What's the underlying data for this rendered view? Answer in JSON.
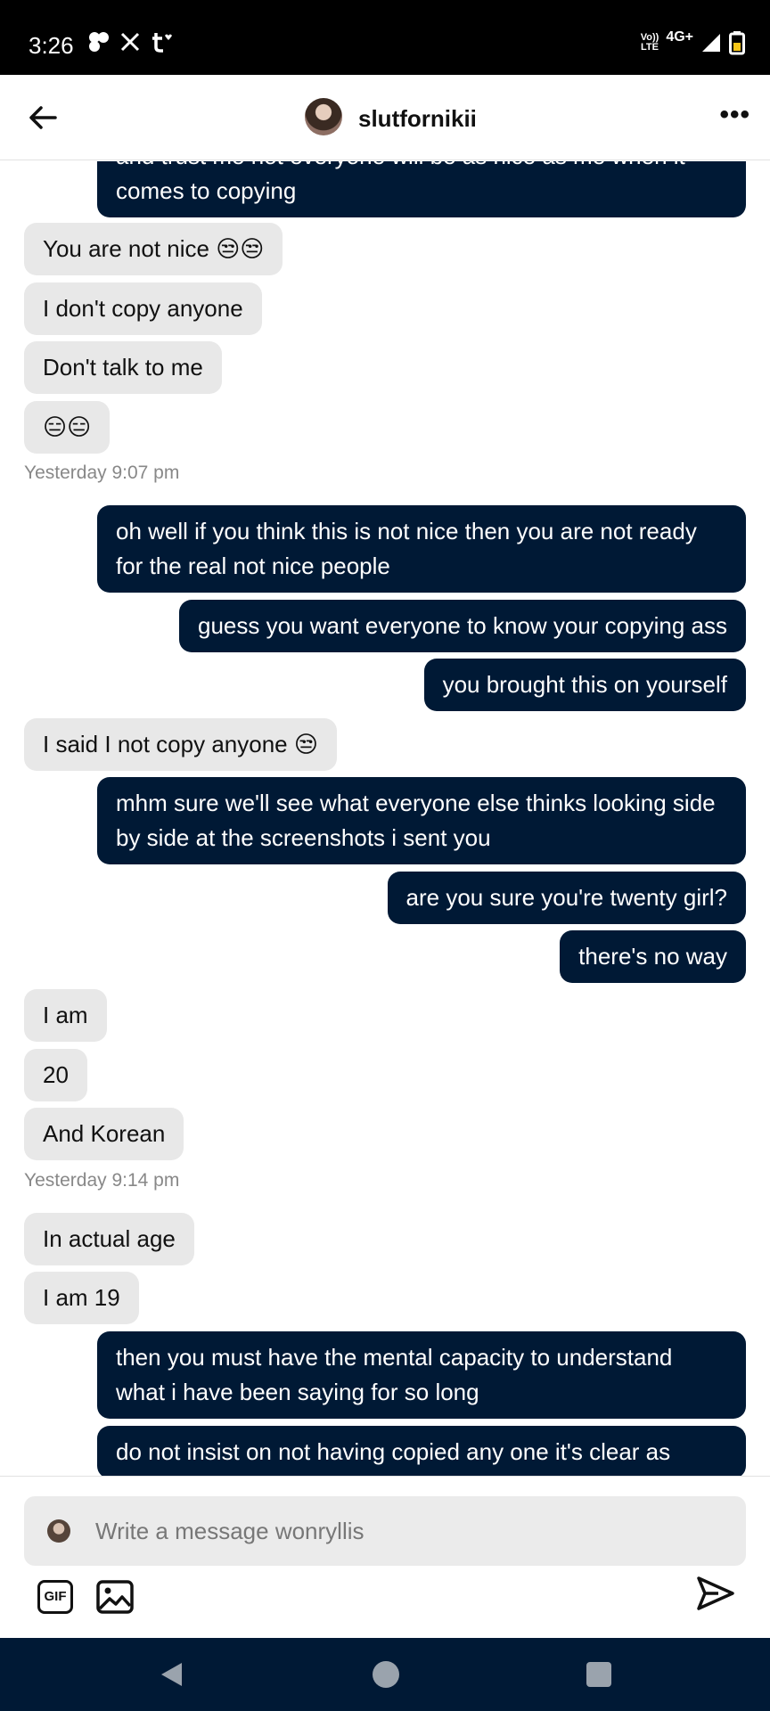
{
  "status": {
    "time": "3:26",
    "volte_line1": "Vo))",
    "volte_line2": "LTE",
    "network": "4G+"
  },
  "header": {
    "contact": "slutfornikii"
  },
  "messages": [
    {
      "dir": "out",
      "text": "and trust me not everyone will be as nice as me when it comes to copying"
    },
    {
      "dir": "in",
      "text": "You are not nice 😒😒"
    },
    {
      "dir": "in",
      "text": "I don't copy anyone"
    },
    {
      "dir": "in",
      "text": "Don't talk to me"
    },
    {
      "dir": "in",
      "text": "😑😑"
    },
    {
      "dir": "stamp",
      "text": "Yesterday 9:07 pm"
    },
    {
      "dir": "out",
      "text": "oh well if you think this is not nice then you are not ready for the real not nice people"
    },
    {
      "dir": "out",
      "text": "guess you want everyone to know your copying ass"
    },
    {
      "dir": "out",
      "text": "you brought this on yourself"
    },
    {
      "dir": "in",
      "text": "I said I not copy anyone 😒"
    },
    {
      "dir": "out",
      "text": "mhm sure we'll see what everyone else thinks looking side by side at the screenshots i sent you"
    },
    {
      "dir": "out",
      "text": "are you sure you're twenty girl?"
    },
    {
      "dir": "out",
      "text": "there's no way"
    },
    {
      "dir": "in",
      "text": "I am"
    },
    {
      "dir": "in",
      "text": "20"
    },
    {
      "dir": "in",
      "text": "And Korean"
    },
    {
      "dir": "stamp",
      "text": "Yesterday 9:14 pm"
    },
    {
      "dir": "in",
      "text": "In actual age"
    },
    {
      "dir": "in",
      "text": "I am 19"
    },
    {
      "dir": "out",
      "text": "then you must have the mental capacity to understand what i have been saying for so long"
    },
    {
      "dir": "out",
      "text": "do not insist on not having copied any one it's clear as"
    }
  ],
  "composer": {
    "placeholder": "Write a message wonryllis",
    "gif_label": "GIF"
  },
  "icons": {
    "back": "back-arrow-icon",
    "more": "more-options-icon",
    "gif": "gif-icon",
    "image": "image-icon",
    "send": "send-icon",
    "photos": "google-photos-icon",
    "x": "x-icon",
    "tumblr": "tumblr-icon"
  },
  "colors": {
    "outgoing_bubble": "#001935",
    "incoming_bubble": "#e8e8e8",
    "nav_bar": "#001935"
  }
}
